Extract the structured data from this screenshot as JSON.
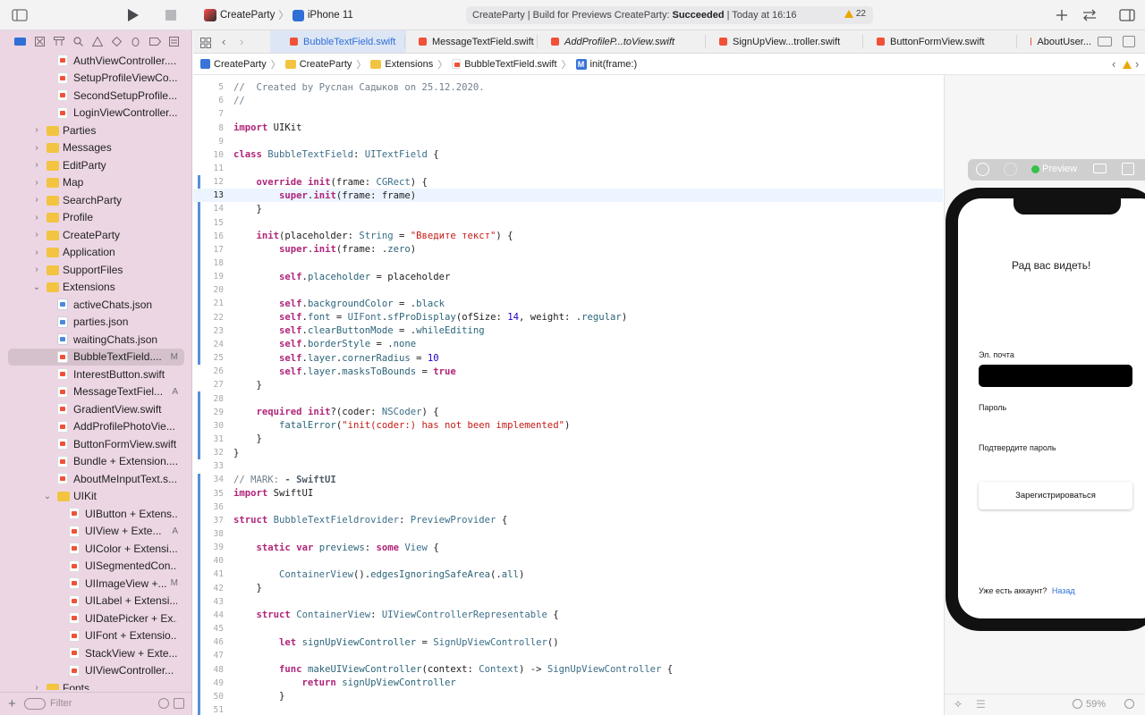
{
  "toolbar": {
    "scheme_name": "CreateParty",
    "scheme_sep": "〉",
    "device_name": "iPhone 11",
    "activity_prefix": "CreateParty | Build for Previews CreateParty:",
    "activity_status": "Succeeded",
    "activity_time": "| Today at 16:16",
    "warning_count": "22"
  },
  "navigator": {
    "rows": [
      {
        "label": "AuthViewController....",
        "kind": "swift",
        "indent": 1
      },
      {
        "label": "SetupProfileViewCo...",
        "kind": "swift",
        "indent": 1
      },
      {
        "label": "SecondSetupProfile...",
        "kind": "swift",
        "indent": 1
      },
      {
        "label": "LoginViewController...",
        "kind": "swift",
        "indent": 1
      },
      {
        "label": "Parties",
        "kind": "folder",
        "indent": 0,
        "chev": "›"
      },
      {
        "label": "Messages",
        "kind": "folder",
        "indent": 0,
        "chev": "›"
      },
      {
        "label": "EditParty",
        "kind": "folder",
        "indent": 0,
        "chev": "›"
      },
      {
        "label": "Map",
        "kind": "folder",
        "indent": 0,
        "chev": "›"
      },
      {
        "label": "SearchParty",
        "kind": "folder",
        "indent": 0,
        "chev": "›"
      },
      {
        "label": "Profile",
        "kind": "folder",
        "indent": 0,
        "chev": "›"
      },
      {
        "label": "CreateParty",
        "kind": "folder",
        "indent": 0,
        "chev": "›"
      },
      {
        "label": "Application",
        "kind": "folder",
        "indent": 0,
        "chev": "›"
      },
      {
        "label": "SupportFiles",
        "kind": "folder",
        "indent": 0,
        "chev": "›"
      },
      {
        "label": "Extensions",
        "kind": "folder",
        "indent": 0,
        "chev": "⌄"
      },
      {
        "label": "activeChats.json",
        "kind": "json",
        "indent": 1
      },
      {
        "label": "parties.json",
        "kind": "json",
        "indent": 1
      },
      {
        "label": "waitingChats.json",
        "kind": "json",
        "indent": 1
      },
      {
        "label": "BubbleTextField....",
        "kind": "swift",
        "indent": 1,
        "badge": "M",
        "selected": true
      },
      {
        "label": "InterestButton.swift",
        "kind": "swift",
        "indent": 1
      },
      {
        "label": "MessageTextFiel...",
        "kind": "swift",
        "indent": 1,
        "badge": "A"
      },
      {
        "label": "GradientView.swift",
        "kind": "swift",
        "indent": 1
      },
      {
        "label": "AddProfilePhotoVie...",
        "kind": "swift",
        "indent": 1
      },
      {
        "label": "ButtonFormView.swift",
        "kind": "swift",
        "indent": 1
      },
      {
        "label": "Bundle + Extension....",
        "kind": "swift",
        "indent": 1
      },
      {
        "label": "AboutMeInputText.s...",
        "kind": "swift",
        "indent": 1
      },
      {
        "label": "UIKit",
        "kind": "folder",
        "indent": 1,
        "chev": "⌄"
      },
      {
        "label": "UIButton + Extens...",
        "kind": "swift",
        "indent": 2
      },
      {
        "label": "UIView + Exte...",
        "kind": "swift",
        "indent": 2,
        "badge": "A"
      },
      {
        "label": "UIColor + Extensi...",
        "kind": "swift",
        "indent": 2
      },
      {
        "label": "UISegmentedCon...",
        "kind": "swift",
        "indent": 2
      },
      {
        "label": "UIImageView +...",
        "kind": "swift",
        "indent": 2,
        "badge": "M"
      },
      {
        "label": "UILabel + Extensi...",
        "kind": "swift",
        "indent": 2
      },
      {
        "label": "UIDatePicker + Ex...",
        "kind": "swift",
        "indent": 2
      },
      {
        "label": "UIFont + Extensio...",
        "kind": "swift",
        "indent": 2
      },
      {
        "label": "StackView + Exte...",
        "kind": "swift",
        "indent": 2
      },
      {
        "label": "UIViewController...",
        "kind": "swift",
        "indent": 2
      },
      {
        "label": "Fonts",
        "kind": "folder",
        "indent": 0,
        "chev": "›"
      }
    ],
    "filter_placeholder": "Filter"
  },
  "tabs": [
    {
      "label": "BubbleTextField.swift",
      "active": true
    },
    {
      "label": "MessageTextField.swift"
    },
    {
      "label": "AddProfileP...toView.swift",
      "italic": true
    },
    {
      "label": "SignUpView...troller.swift"
    },
    {
      "label": "ButtonFormView.swift"
    },
    {
      "label": "AboutUser..."
    }
  ],
  "jumpbar": {
    "project": "CreateParty",
    "group": "CreateParty",
    "folder": "Extensions",
    "file": "BubbleTextField.swift",
    "symbol": "init(frame:)",
    "sep": "〉",
    "symbol_badge": "M"
  },
  "code": [
    {
      "n": "5",
      "h": "<span class='cm'>//  Created by Руслан Садыков on 25.12.2020.</span>"
    },
    {
      "n": "6",
      "h": "<span class='cm'>//</span>"
    },
    {
      "n": "7",
      "h": ""
    },
    {
      "n": "8",
      "h": "<span class='kw'>import</span> UIKit"
    },
    {
      "n": "9",
      "h": ""
    },
    {
      "n": "10",
      "h": "<span class='kw'>class</span> <span class='ty'>BubbleTextField</span>: <span class='ty'>UITextField</span> {"
    },
    {
      "n": "11",
      "h": ""
    },
    {
      "n": "12",
      "h": "    <span class='kw'>override</span> <span class='kw'>init</span>(frame: <span class='ty'>CGRect</span>) {"
    },
    {
      "n": "13",
      "h": "        <span class='kw'>super</span>.<span class='kw'>init</span>(frame: frame)",
      "cur": true
    },
    {
      "n": "14",
      "h": "    }"
    },
    {
      "n": "15",
      "h": ""
    },
    {
      "n": "16",
      "h": "    <span class='kw'>init</span>(placeholder: <span class='ty'>String</span> = <span class='st'>\"Введите текст\"</span>) {"
    },
    {
      "n": "17",
      "h": "        <span class='kw'>super</span>.<span class='kw'>init</span>(frame: .<span class='fn'>zero</span>)"
    },
    {
      "n": "18",
      "h": ""
    },
    {
      "n": "19",
      "h": "        <span class='kw'>self</span>.<span class='fn'>placeholder</span> = placeholder"
    },
    {
      "n": "20",
      "h": ""
    },
    {
      "n": "21",
      "h": "        <span class='kw'>self</span>.<span class='fn'>backgroundColor</span> = .<span class='fn'>black</span>"
    },
    {
      "n": "22",
      "h": "        <span class='kw'>self</span>.<span class='fn'>font</span> = <span class='ty'>UIFont</span>.<span class='fn'>sfProDisplay</span>(ofSize: <span class='nm'>14</span>, weight: .<span class='fn'>regular</span>)"
    },
    {
      "n": "23",
      "h": "        <span class='kw'>self</span>.<span class='fn'>clearButtonMode</span> = .<span class='fn'>whileEditing</span>"
    },
    {
      "n": "24",
      "h": "        <span class='kw'>self</span>.<span class='fn'>borderStyle</span> = .<span class='fn'>none</span>"
    },
    {
      "n": "25",
      "h": "        <span class='kw'>self</span>.<span class='fn'>layer</span>.<span class='fn'>cornerRadius</span> = <span class='nm'>10</span>"
    },
    {
      "n": "26",
      "h": "        <span class='kw'>self</span>.<span class='fn'>layer</span>.<span class='fn'>masksToBounds</span> = <span class='kw'>true</span>"
    },
    {
      "n": "27",
      "h": "    }"
    },
    {
      "n": "28",
      "h": ""
    },
    {
      "n": "29",
      "h": "    <span class='kw'>required</span> <span class='kw'>init</span>?(coder: <span class='ty'>NSCoder</span>) {"
    },
    {
      "n": "30",
      "h": "        <span class='fn'>fatalError</span>(<span class='st'>\"init(coder:) has not been implemented\"</span>)"
    },
    {
      "n": "31",
      "h": "    }"
    },
    {
      "n": "32",
      "h": "}"
    },
    {
      "n": "33",
      "h": ""
    },
    {
      "n": "34",
      "h": "<span class='cm'>// MARK: </span><span class='cmb'>- SwiftUI</span>"
    },
    {
      "n": "35",
      "h": "<span class='kw'>import</span> SwiftUI"
    },
    {
      "n": "36",
      "h": ""
    },
    {
      "n": "37",
      "h": "<span class='kw'>struct</span> <span class='ty'>BubbleTextFieldrovider</span>: <span class='ty'>PreviewProvider</span> {"
    },
    {
      "n": "38",
      "h": ""
    },
    {
      "n": "39",
      "h": "    <span class='kw'>static</span> <span class='kw'>var</span> <span class='fn'>previews</span>: <span class='kw'>some</span> <span class='ty'>View</span> {"
    },
    {
      "n": "40",
      "h": ""
    },
    {
      "n": "41",
      "h": "        <span class='ty'>ContainerView</span>().<span class='fn'>edgesIgnoringSafeArea</span>(.<span class='fn'>all</span>)"
    },
    {
      "n": "42",
      "h": "    }"
    },
    {
      "n": "43",
      "h": ""
    },
    {
      "n": "44",
      "h": "    <span class='kw'>struct</span> <span class='ty'>ContainerView</span>: <span class='ty'>UIViewControllerRepresentable</span> {"
    },
    {
      "n": "45",
      "h": ""
    },
    {
      "n": "46",
      "h": "        <span class='kw'>let</span> <span class='fn'>signUpViewController</span> = <span class='ty'>SignUpViewController</span>()"
    },
    {
      "n": "47",
      "h": ""
    },
    {
      "n": "48",
      "h": "        <span class='kw'>func</span> <span class='fn'>makeUIViewController</span>(context: <span class='ty'>Context</span>) -> <span class='ty'>SignUpViewController</span> {"
    },
    {
      "n": "49",
      "h": "            <span class='kw'>return</span> <span class='fn'>signUpViewController</span>"
    },
    {
      "n": "50",
      "h": "        }"
    },
    {
      "n": "51",
      "h": ""
    }
  ],
  "preview": {
    "label": "Preview",
    "title": "Рад вас видеть!",
    "email_label": "Эл. почта",
    "password_label": "Пароль",
    "confirm_label": "Подтвердите пароль",
    "register_button": "Зарегистрироваться",
    "have_account": "Уже есть аккаунт?",
    "back_link": "Назад",
    "zoom": "59%"
  },
  "colors": {
    "accent": "#2f6fd6",
    "navigator_bg": "#ecd6e3",
    "warning": "#e8a800"
  }
}
